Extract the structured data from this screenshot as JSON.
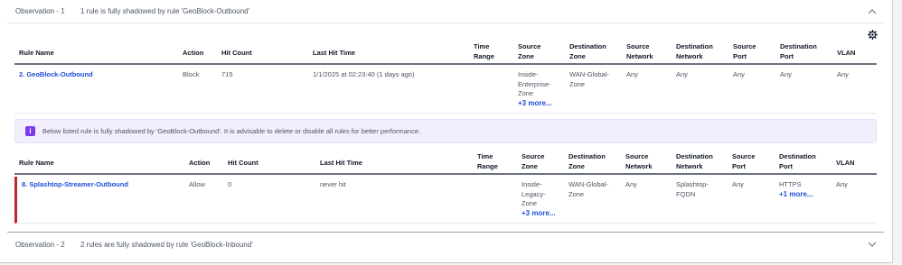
{
  "observation1": {
    "title": "Observation - 1",
    "description": "1 rule is fully shadowed by rule 'GeoBlock-Outbound'"
  },
  "observation2": {
    "title": "Observation - 2",
    "description": "2 rules are fully shadowed by rule 'GeoBlock-Inbound'"
  },
  "columns": {
    "rule_name": "Rule Name",
    "action": "Action",
    "hit_count": "Hit Count",
    "last_hit_time": "Last Hit Time",
    "time_range_1": "Time",
    "time_range_2": "Range",
    "source_zone_1": "Source",
    "source_zone_2": "Zone",
    "dest_zone_1": "Destination",
    "dest_zone_2": "Zone",
    "source_network_1": "Source",
    "source_network_2": "Network",
    "dest_network_1": "Destination",
    "dest_network_2": "Network",
    "source_port_1": "Source",
    "source_port_2": "Port",
    "dest_port_1": "Destination",
    "dest_port_2": "Port",
    "vlan": "VLAN"
  },
  "shadowing_rule": {
    "name": "2. GeoBlock-Outbound",
    "action": "Block",
    "hit_count": "715",
    "last_hit_time": "1/1/2025 at 02:23:40 (1 days ago)",
    "source_zone_lines": [
      "Inside-",
      "Enterprise-",
      "Zone"
    ],
    "source_zone_more": "+3 more...",
    "dest_zone_lines": [
      "WAN-Global-",
      "Zone"
    ],
    "source_network": "Any",
    "dest_network": "Any",
    "source_port": "Any",
    "dest_port": "Any",
    "vlan": "Any"
  },
  "alert": {
    "icon": "info-icon",
    "text": "Below listed rule is fully shadowed by 'GeoBlock-Outbound'. It is advisable to delete or disable all rules for better performance."
  },
  "shadowed_rule": {
    "name": "8. Splashtop-Streamer-Outbound",
    "action": "Allow",
    "hit_count": "0",
    "last_hit_time": "never hit",
    "source_zone_lines": [
      "Inside-",
      "Legacy-",
      "Zone"
    ],
    "source_zone_more": "+3 more...",
    "dest_zone_lines": [
      "WAN-Global-",
      "Zone"
    ],
    "source_network": "Any",
    "dest_network_lines": [
      "Splashtop-",
      "FQDN"
    ],
    "source_port": "Any",
    "dest_port": "HTTPS",
    "dest_port_more": "+1 more...",
    "vlan": "Any"
  },
  "colors": {
    "link": "#1d4ed8",
    "alert_bg": "#f3eefe",
    "alert_icon": "#7c3aed",
    "shadowed_marker": "#c0263a"
  }
}
